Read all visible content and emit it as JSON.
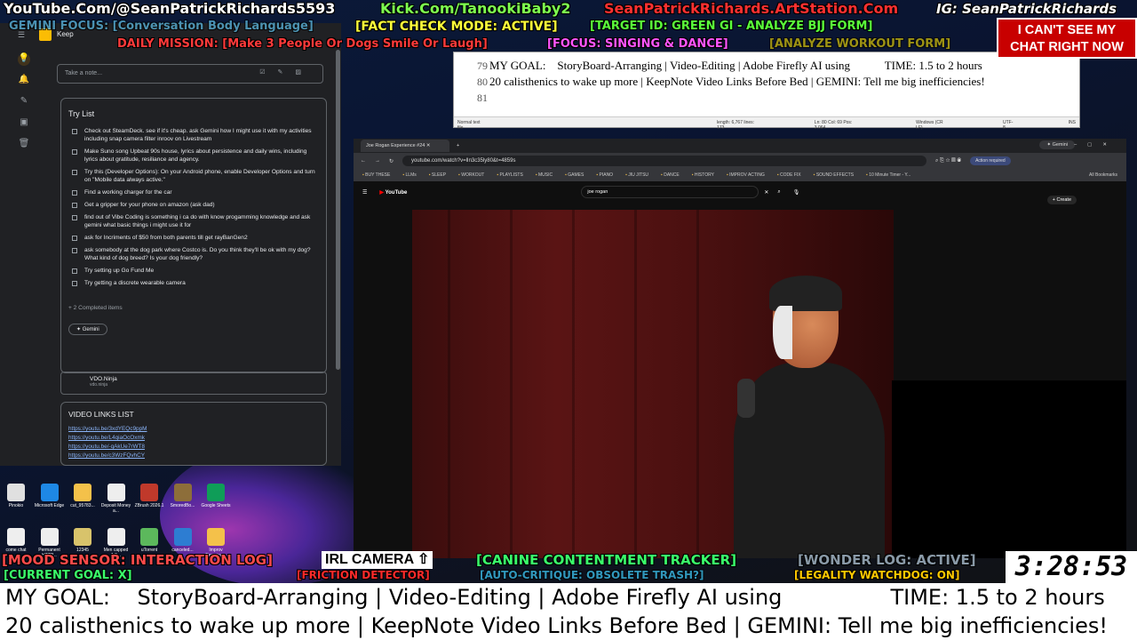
{
  "overlay": {
    "youtube": "YouTube.Com/@SeanPatrickRichards5593",
    "kick": "Kick.Com/TanookiBaby2",
    "artstation": "SeanPatrickRichards.ArtStation.Com",
    "ig": "IG: SeanPatrickRichards",
    "gemini_focus": "GEMINI FOCUS:  [Conversation Body Language]",
    "fact_check": "[FACT CHECK MODE: ACTIVE]",
    "target": "[TARGET ID: GREEN GI - ANALYZE BJJ FORM]",
    "daily_mission": "DAILY MISSION: [Make 3 People Or Dogs Smile Or Laugh]",
    "focus_singing": "[FOCUS: SINGING & DANCE]",
    "analyze_workout": "[ANALYZE WORKOUT FORM]",
    "chat_line1": "I CAN'T SEE MY",
    "chat_line2": "CHAT RIGHT NOW",
    "mood_sensor": "[MOOD SENSOR: INTERACTION LOG]",
    "irl_camera": "IRL CAMERA",
    "canine": "[CANINE CONTENTMENT TRACKER]",
    "wonder_log": "[WONDER LOG: ACTIVE]",
    "current_goal": "[CURRENT GOAL: X]",
    "friction": "[FRICTION DETECTOR]",
    "auto_critique": "[AUTO-CRITIQUE: OBSOLETE TRASH?]",
    "legality": "[LEGALITY WATCHDOG: ON]",
    "timer": "3:28:53",
    "bottom_line1": "MY GOAL:    StoryBoard-Arranging | Video-Editing | Adobe Firefly AI using                TIME: 1.5 to 2 hours",
    "bottom_line2": "20 calisthenics to wake up more | KeepNote Video Links Before Bed | GEMINI: Tell me big inefficiencies!"
  },
  "keep": {
    "app_name": "Keep",
    "take_note_placeholder": "Take a note...",
    "list_title": "Try List",
    "items": [
      "Check out SteamDeck. see if it's cheap. ask Gemini how I might use it with my activities including snap camera filter inroov on Livestream",
      "Make Suno song Upbeat 90s house, lyrics about persistence and daily wins, including lyrics about gratitude, resiliance and agency.",
      "Try this (Developer Options): On your Android phone, enable Developer Options and turn on \"Mobile data always active.\"",
      "Find a working charger for the car",
      "Get a gripper for your phone on amazon (ask dad)",
      "find out of Vibe Coding is something i ca do with know progamming knowledge and ask gemini what basic things i might use it for",
      "ask for Incriments of $50 from both parents till get rayBanGen2",
      "ask somebody at the dog park where Costco is. Do you think they'll be ok with my dog? What kind of dog breed? Is your dog friendly?",
      "Try setting up Go Fund Me",
      "Try getting a discrete wearable camera"
    ],
    "completed": "+ 2 Completed items",
    "gemini_chip": "Gemini",
    "vdo_title": "VDO.Ninja",
    "vdo_sub": "vdo.ninja",
    "links_title": "VIDEO LINKS LIST",
    "links": [
      "https://youtu.be/3xdYEQc9ppM",
      "https://youtu.be/L4qiaOcOxmk",
      "https://youtu.be/-qAkUe7rWT8",
      "https://youtu.be/c3WzFQvhCY"
    ]
  },
  "notepad": {
    "line_numbers": [
      "79",
      "80",
      "81"
    ],
    "line79": "MY GOAL:    StoryBoard-Arranging | Video-Editing | Adobe Firefly AI using            TIME: 1.5 to 2 hours",
    "line80": "20 calisthenics to wake up more | KeepNote Video Links Before Bed | GEMINI: Tell me big inefficiencies!",
    "status_type": "Normal text file",
    "status_length": "length: 6,767   lines: 173",
    "status_pos": "Ln: 80   Col: 69   Pos: 3,064",
    "status_eol": "Windows (CR LF)",
    "status_enc": "UTF-8",
    "status_ins": "INS"
  },
  "browser": {
    "tab_title": "Joe Rogan Experience #24",
    "gemini_tab": "Gemini",
    "url": "youtube.com/watch?v=lIn3c35ly80&t=4859s",
    "action_required": "Action required",
    "bookmarks": [
      "BUY THESE",
      "LLMs",
      "SLEEP",
      "WORKOUT",
      "PLAYLISTS",
      "MUSIC",
      "GAMES",
      "PIANO",
      "JIU JITSU",
      "DANCE",
      "HISTORY",
      "IMPROV ACTING",
      "CODE FIX",
      "SOUND EFFECTS",
      "10 Minute Timer - Y..."
    ],
    "all_bookmarks": "All Bookmarks",
    "yt_logo": "YouTube",
    "search_value": "joe rogan",
    "create": "+ Create"
  },
  "desktop_icons": [
    {
      "label": "Pinokio",
      "color": "#e0e0e0"
    },
    {
      "label": "Microsoft Edge",
      "color": "#1e88e5"
    },
    {
      "label": "cut_95783...",
      "color": "#f4c14a"
    },
    {
      "label": "Deposit Money a...",
      "color": "#eeeeee"
    },
    {
      "label": "ZBrush 2026.1",
      "color": "#c0392b"
    },
    {
      "label": "SmoredBo...",
      "color": "#8d6e3a"
    },
    {
      "label": "Google Sheets",
      "color": "#0f9d58"
    },
    {
      "label": "come chat",
      "color": "#eeeeee"
    },
    {
      "label": "Permanent HTTP...",
      "color": "#eeeeee"
    },
    {
      "label": "12345",
      "color": "#d8c36b"
    },
    {
      "label": "Men capped 1.0...",
      "color": "#eeeeee"
    },
    {
      "label": "uTorrent",
      "color": "#5cb85c"
    },
    {
      "label": "canceled...",
      "color": "#2d7dd2"
    },
    {
      "label": "Improv Exercise...",
      "color": "#f4c14a"
    }
  ]
}
